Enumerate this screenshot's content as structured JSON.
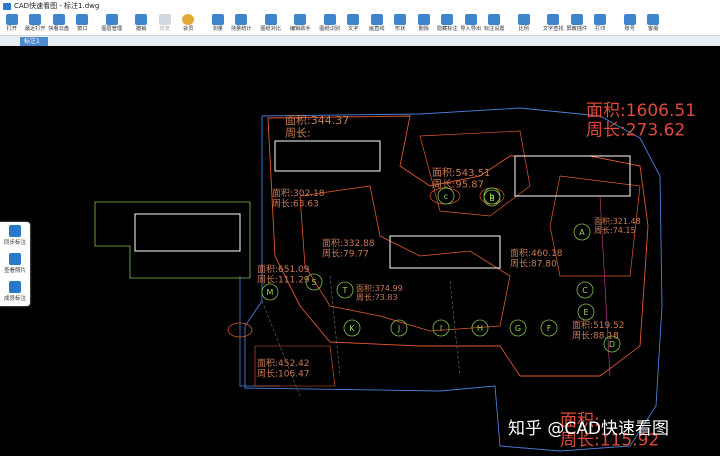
{
  "window": {
    "title": "CAD快速看图 - 标注1.dwg"
  },
  "toolbar": {
    "buttons": [
      {
        "id": "open",
        "label": "打开",
        "color": "#2a78c8"
      },
      {
        "id": "recent",
        "label": "最近打开",
        "color": "#2a78c8"
      },
      {
        "id": "cloud",
        "label": "快看云盘",
        "color": "#2a78c8"
      },
      {
        "id": "window",
        "label": "窗口",
        "color": "#2a78c8"
      },
      {
        "id": "layers",
        "label": "图层管理",
        "color": "#2a78c8"
      },
      {
        "id": "undo",
        "label": "撤销",
        "color": "#2a78c8"
      },
      {
        "id": "redo",
        "label": "恢复",
        "color": "#9aa8b8",
        "disabled": true
      },
      {
        "id": "vip",
        "label": "会员",
        "color": "#e0a020"
      },
      {
        "id": "measure",
        "label": "测量",
        "color": "#2a78c8"
      },
      {
        "id": "stats",
        "label": "测量统计",
        "color": "#2a78c8"
      },
      {
        "id": "compare",
        "label": "图纸对比",
        "color": "#2a78c8"
      },
      {
        "id": "assistant",
        "label": "编辑助手",
        "color": "#2a78c8"
      },
      {
        "id": "recognize",
        "label": "图纸识别",
        "color": "#2a78c8"
      },
      {
        "id": "text",
        "label": "文字",
        "color": "#2a78c8"
      },
      {
        "id": "line",
        "label": "画直线",
        "color": "#2a78c8"
      },
      {
        "id": "shape",
        "label": "形状",
        "color": "#2a78c8"
      },
      {
        "id": "delete",
        "label": "删除",
        "color": "#2a78c8"
      },
      {
        "id": "hide",
        "label": "隐藏标注",
        "color": "#2a78c8"
      },
      {
        "id": "export",
        "label": "导入导出",
        "color": "#2a78c8"
      },
      {
        "id": "marksetting",
        "label": "标注设置",
        "color": "#2a78c8"
      },
      {
        "id": "scale",
        "label": "比例",
        "color": "#2a78c8"
      },
      {
        "id": "textsearch",
        "label": "文字查找",
        "color": "#2a78c8"
      },
      {
        "id": "screen",
        "label": "屏蔽插件",
        "color": "#2a78c8"
      },
      {
        "id": "print",
        "label": "打印",
        "color": "#2a78c8"
      },
      {
        "id": "account",
        "label": "账号",
        "color": "#2a78c8"
      },
      {
        "id": "service",
        "label": "客服",
        "color": "#2a78c8"
      }
    ]
  },
  "tabs": [
    {
      "label": "标注1"
    }
  ],
  "side_panel": {
    "items": [
      {
        "label": "同步标注",
        "icon": "sync-icon"
      },
      {
        "label": "查看照片",
        "icon": "photo-icon"
      },
      {
        "label": "成员标注",
        "icon": "members-icon"
      }
    ]
  },
  "drawing": {
    "area_labels": [
      {
        "area": "面积:1606.51",
        "perim": "周长:273.62",
        "color": "#e04a3a"
      },
      {
        "area": "面积:344.37",
        "perim": "周长:",
        "color": "#c97a52"
      },
      {
        "area": "面积:543.51",
        "perim": "周长:95.87",
        "color": "#c97a52"
      },
      {
        "area": "面积:302.18",
        "perim": "周长:63.63",
        "color": "#c97a52"
      },
      {
        "area": "面积:651.09",
        "perim": "周长:111.29",
        "color": "#c97a52"
      },
      {
        "area": "面积:460.18",
        "perim": "周长:87.80",
        "color": "#c97a52"
      },
      {
        "area": "面积:452.42",
        "perim": "周长:106.47",
        "color": "#c97a52"
      },
      {
        "area": "面积:519.52",
        "perim": "周长:88.18",
        "color": "#c97a52"
      },
      {
        "area": "面积:332.88",
        "perim": "周长:79.77",
        "color": "#c97a52"
      },
      {
        "area": "面积:321.48",
        "perim": "周长:74.15",
        "color": "#c97a52"
      },
      {
        "area": "面积:374.99",
        "perim": "周长:73.83",
        "color": "#c97a52"
      },
      {
        "area": "面积:",
        "perim": "周长:115.92",
        "color": "#e04a3a"
      }
    ],
    "grid_markers": [
      "S",
      "T",
      "K",
      "J",
      "I",
      "H",
      "G",
      "F",
      "M",
      "C",
      "E",
      "D",
      "B",
      "A",
      "c",
      "b"
    ]
  },
  "watermark": "知乎 @CAD快速看图"
}
